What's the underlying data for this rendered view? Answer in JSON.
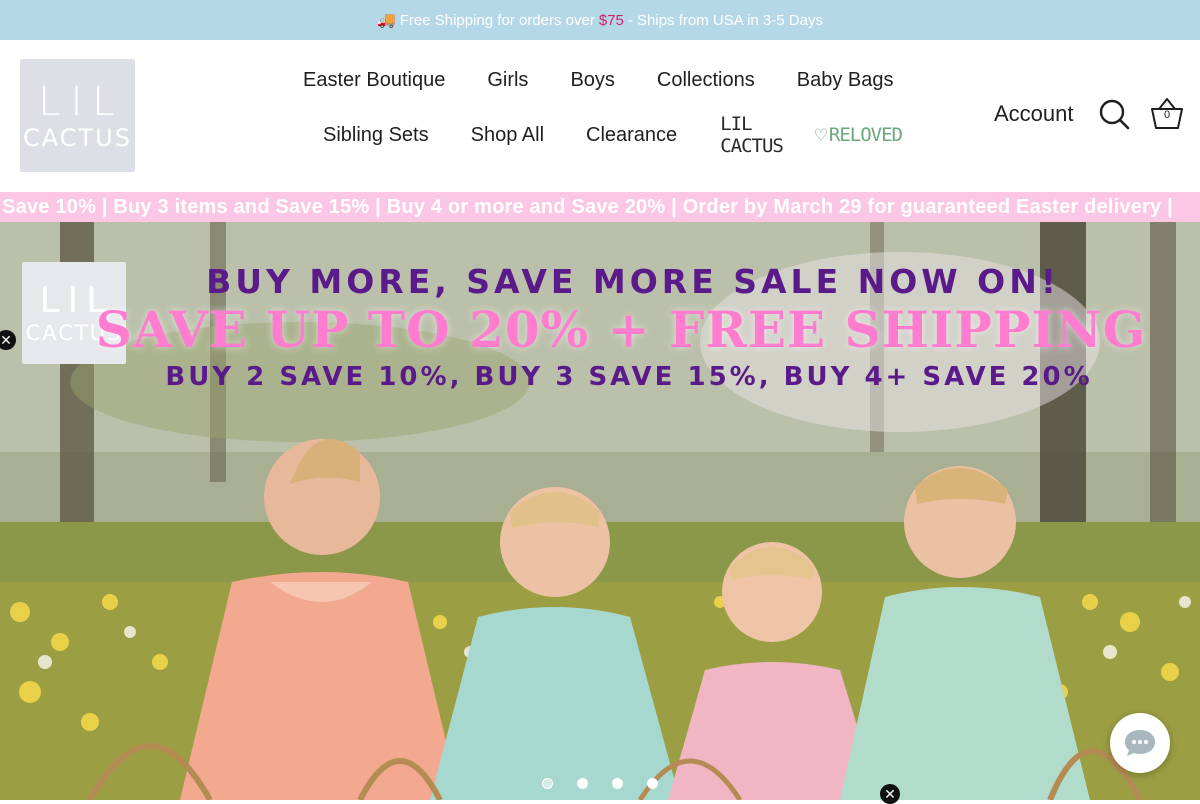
{
  "announcement": {
    "truck_icon": "🚚",
    "text_before": "Free Shipping for orders over",
    "price": "$75",
    "text_after": "- Ships from USA in 3-5 Days"
  },
  "brand": {
    "logo_line1": "LIL",
    "logo_line2": "CACTUS"
  },
  "nav": {
    "row1": [
      "Easter Boutique",
      "Girls",
      "Boys",
      "Collections",
      "Baby Bags"
    ],
    "row2": [
      "Sibling Sets",
      "Shop All",
      "Clearance"
    ],
    "reloved_part1": "LIL CACTUS",
    "reloved_part2": "RELOVED"
  },
  "header": {
    "account_label": "Account",
    "cart_count": "0"
  },
  "promo": {
    "text": "d Save 10% | Buy 3 items and Save 15% | Buy 4 or more and Save 20% | Order by March 29 for guaranteed Easter delivery |"
  },
  "hero": {
    "logo_line1": "LIL",
    "logo_line2": "CACTUS",
    "line1": "BUY MORE, SAVE MORE SALE NOW ON!",
    "line2": "SAVE UP TO 20% + FREE SHIPPING",
    "line3": "BUY 2 SAVE 10%, BUY 3 SAVE 15%, BUY 4+ SAVE 20%",
    "slide_count": 4,
    "active_slide": 1
  },
  "icons": {
    "close": "✕"
  },
  "colors": {
    "announcement_bg": "#b5d8e8",
    "price_accent": "#d41f6a",
    "promo_bg": "#fcc6e5",
    "headline_purple": "#5a1a8a",
    "headline_pink": "#ff7ccf"
  }
}
